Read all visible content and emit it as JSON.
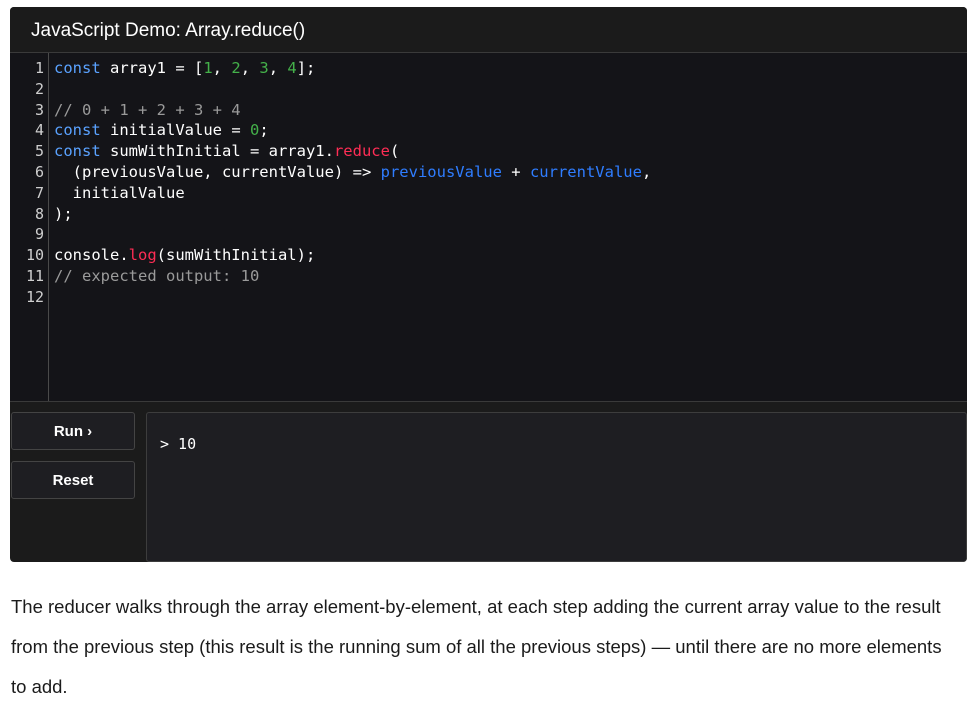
{
  "demo": {
    "title": "JavaScript Demo: Array.reduce()",
    "code_lines": [
      {
        "n": "1",
        "html": "<span class=\"kw\">const</span> array1 = [<span class=\"num\">1</span>, <span class=\"num\">2</span>, <span class=\"num\">3</span>, <span class=\"num\">4</span>];"
      },
      {
        "n": "2",
        "html": ""
      },
      {
        "n": "3",
        "html": "<span class=\"cm\">// 0 + 1 + 2 + 3 + 4</span>"
      },
      {
        "n": "4",
        "html": "<span class=\"kw\">const</span> initialValue = <span class=\"num\">0</span>;"
      },
      {
        "n": "5",
        "html": "<span class=\"kw\">const</span> sumWithInitial = array1.<span class=\"fn\">reduce</span>("
      },
      {
        "n": "6",
        "html": "  (previousValue, currentValue) =&gt; <span class=\"par\">previousValue</span> + <span class=\"par\">currentValue</span>,"
      },
      {
        "n": "7",
        "html": "  initialValue"
      },
      {
        "n": "8",
        "html": ");"
      },
      {
        "n": "9",
        "html": ""
      },
      {
        "n": "10",
        "html": "console.<span class=\"fn\">log</span>(sumWithInitial);"
      },
      {
        "n": "11",
        "html": "<span class=\"cm\">// expected output: 10</span>"
      },
      {
        "n": "12",
        "html": ""
      }
    ],
    "run_label": "Run ›",
    "reset_label": "Reset",
    "console_output": "> 10"
  },
  "description": "The reducer walks through the array element-by-element, at each step adding the current array value to the result from the previous step (this result is the running sum of all the previous steps) — until there are no more elements to add."
}
